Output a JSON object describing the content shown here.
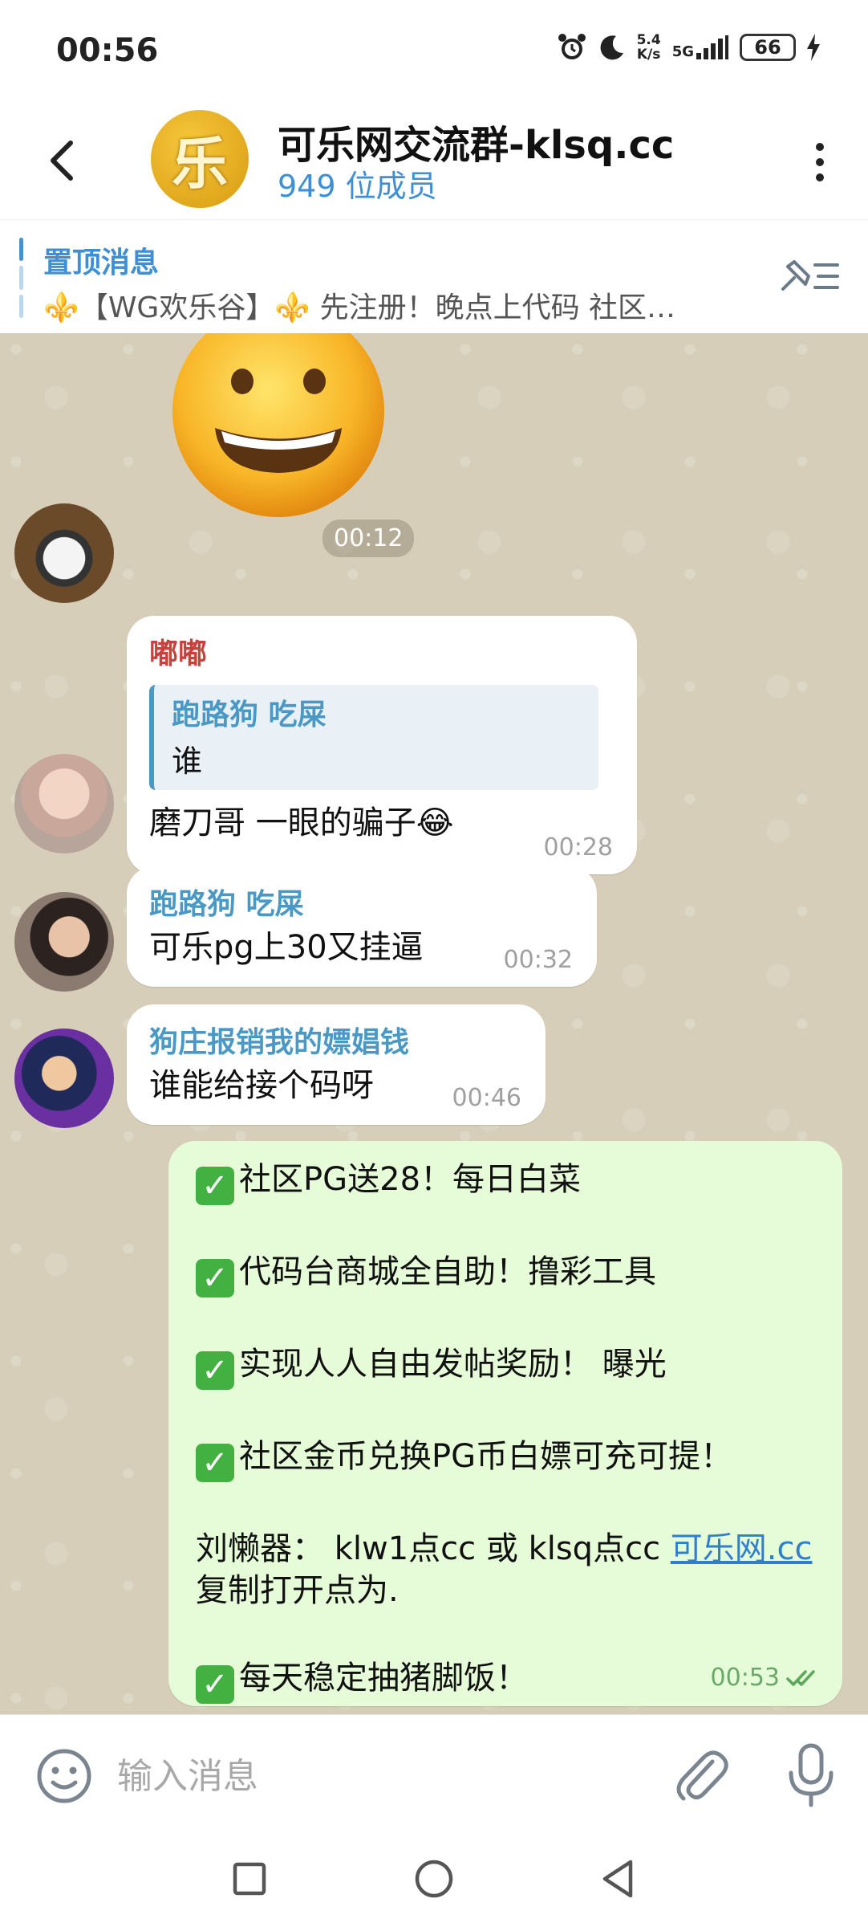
{
  "status_bar": {
    "time": "00:56",
    "net_speed_value": "5.4",
    "net_speed_unit": "K/s",
    "network": "5G",
    "battery": "66"
  },
  "header": {
    "avatar_char": "乐",
    "title": "可乐网交流群-klsq.cc",
    "members": "949 位成员"
  },
  "pinned": {
    "title": "置顶消息",
    "text": "⚜️【WG欢乐谷】⚜️ 先注册！晚点上代码 社区…"
  },
  "messages": {
    "sticker_time": "00:12",
    "m1": {
      "sender": "嘟嘟",
      "reply_name": "跑路狗 吃屎",
      "reply_text": "谁",
      "text": "磨刀哥 一眼的骗子😂",
      "time": "00:28"
    },
    "m2": {
      "sender": "跑路狗 吃屎",
      "text": "可乐pg上30又挂逼",
      "time": "00:32"
    },
    "m3": {
      "sender": "狗庄报销我的嫖娼钱",
      "text": "谁能给接个码呀",
      "time": "00:46"
    },
    "m4": {
      "line1": "社区PG送28！每日白菜",
      "line2": "代码台商城全自助！撸彩工具",
      "line3": "实现人人自由发帖奖励！ 曝光",
      "line4": "社区金币兑换PG币白嫖可充可提！",
      "line5_prefix": "刘懒器： klw1点cc 或 klsq点cc ",
      "line5_link": "可乐网.cc",
      "line5_suffix": " 复制打开点为.",
      "line6": "每天稳定抽猪脚饭！",
      "check_glyph": "✓",
      "time": "00:53"
    }
  },
  "input": {
    "placeholder": "输入消息"
  },
  "colors": {
    "accent": "#3d8fd8",
    "own_bubble": "#e6fbd8",
    "chat_background": "#d6ceb8",
    "sender_red": "#c8413c"
  }
}
